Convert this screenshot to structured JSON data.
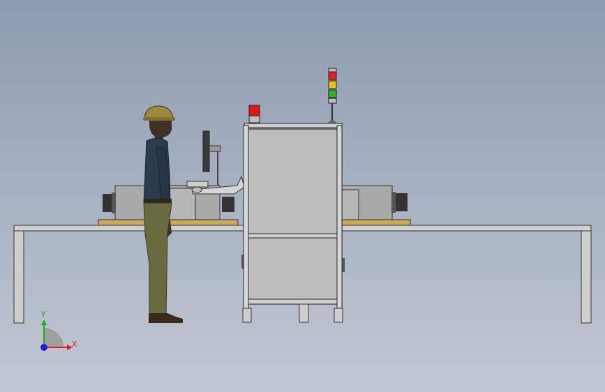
{
  "viewport": {
    "background_top": "#8d9bb0",
    "background_bottom": "#c2c8d3"
  },
  "triad": {
    "x_label": "X",
    "y_label": "Y",
    "x_color": "#e02020",
    "y_color": "#18b018",
    "z_color": "#2020d0"
  },
  "stack_light": {
    "colors": [
      "#e02020",
      "#e8c020",
      "#30b030"
    ]
  },
  "beacon": {
    "color": "#e01818"
  },
  "model_colors": {
    "frame": "#c8c8c8",
    "panel": "#bdbdbd",
    "wood_plate": "#c9a860",
    "machine_body": "#a9a9a9",
    "worker_shirt": "#2b3c4c",
    "worker_pants": "#6a6a40",
    "worker_helmet": "#9a8a3a"
  }
}
